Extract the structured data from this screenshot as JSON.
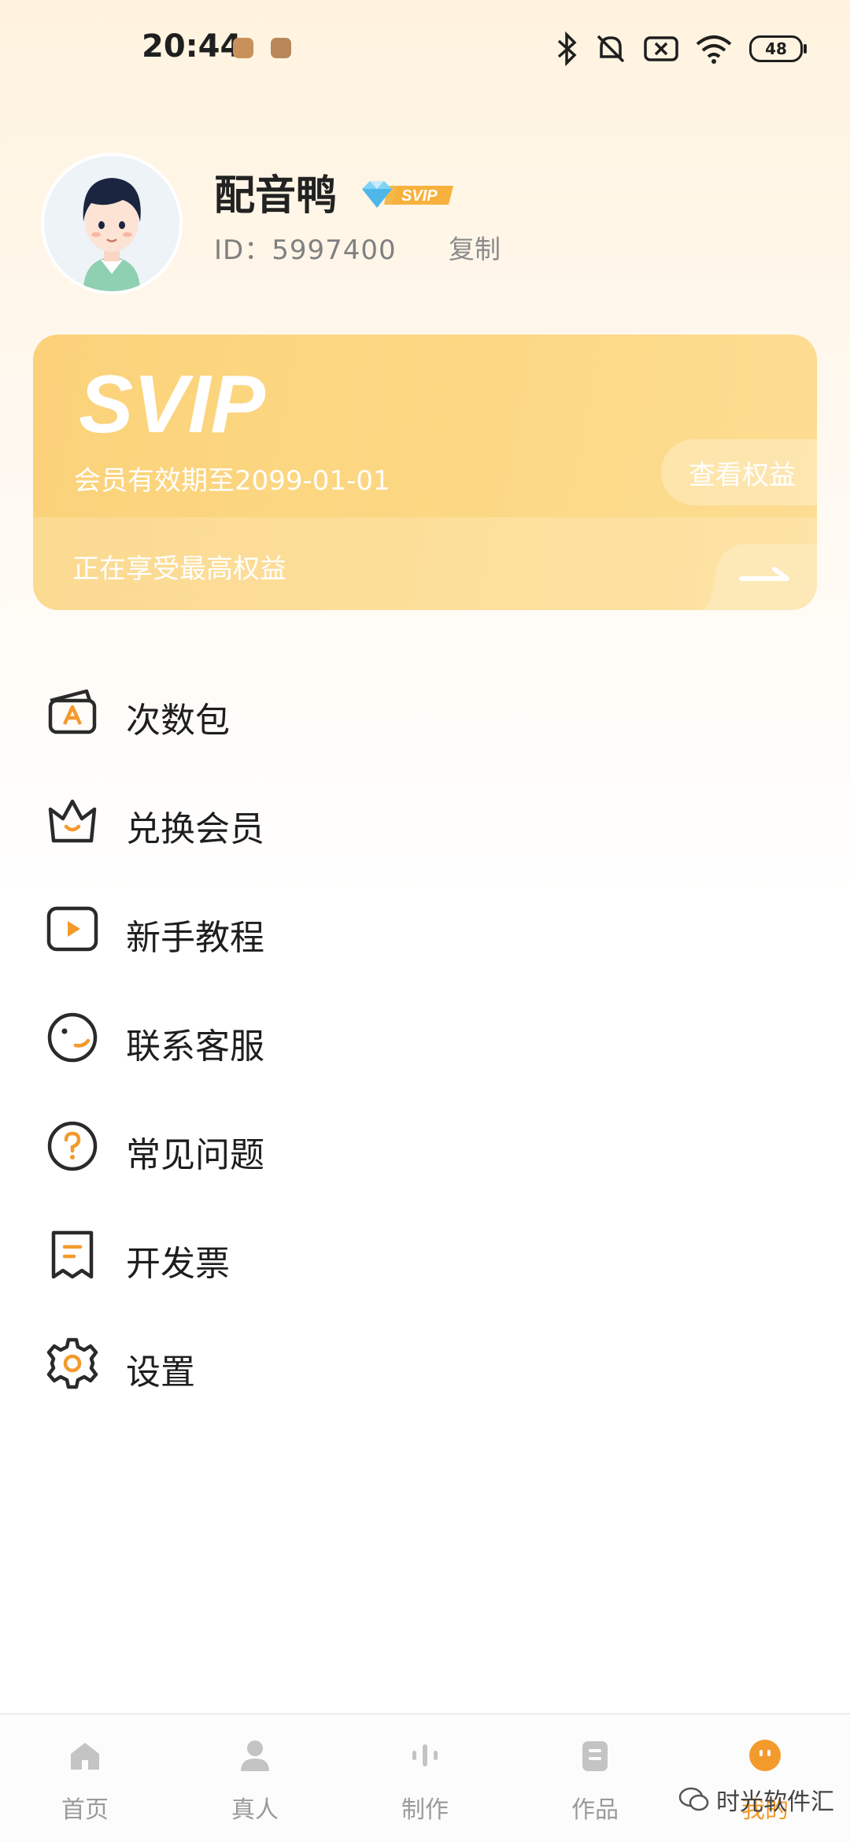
{
  "status_bar": {
    "time": "20:44",
    "battery": "48",
    "icons": [
      "bluetooth-icon",
      "mute-icon",
      "sim-off-icon",
      "wifi-icon",
      "battery-icon"
    ]
  },
  "profile": {
    "username": "配音鸭",
    "badge": "SVIP",
    "id_text": "ID：5997400",
    "copy_label": "复制"
  },
  "vip_card": {
    "logo": "SVIP",
    "expiry": "会员有效期至2099-01-01",
    "view_benefits": "查看权益",
    "benefit_status": "正在享受最高权益"
  },
  "menu": [
    {
      "label": "次数包",
      "icon": "wallet-a-icon"
    },
    {
      "label": "兑换会员",
      "icon": "crown-icon"
    },
    {
      "label": "新手教程",
      "icon": "play-icon"
    },
    {
      "label": "联系客服",
      "icon": "smile-face-icon"
    },
    {
      "label": "常见问题",
      "icon": "question-icon"
    },
    {
      "label": "开发票",
      "icon": "receipt-icon"
    },
    {
      "label": "设置",
      "icon": "gear-icon"
    }
  ],
  "bottom_nav": [
    {
      "label": "首页",
      "icon": "home-icon",
      "active": false
    },
    {
      "label": "真人",
      "icon": "person-icon",
      "active": false
    },
    {
      "label": "制作",
      "icon": "waveform-icon",
      "active": false
    },
    {
      "label": "作品",
      "icon": "works-icon",
      "active": false
    },
    {
      "label": "我的",
      "icon": "me-face-icon",
      "active": true
    }
  ],
  "watermark": "时光软件汇",
  "colors": {
    "accent": "#f39a2c",
    "card": "#fbd27a",
    "text": "#1e1e1e"
  }
}
